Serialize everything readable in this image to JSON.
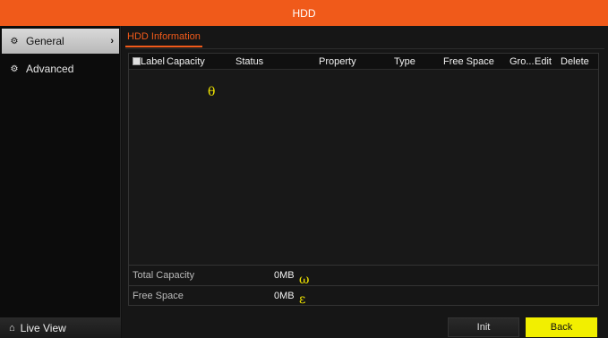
{
  "window": {
    "title": "HDD"
  },
  "sidebar": {
    "items": [
      {
        "label": "General",
        "icon": "gear-icon",
        "active": true
      },
      {
        "label": "Advanced",
        "icon": "settings-icon",
        "active": false
      }
    ],
    "live_view": {
      "label": "Live View",
      "icon": "home-icon"
    }
  },
  "main": {
    "tabs": [
      {
        "label": "HDD Information"
      }
    ],
    "table": {
      "columns": [
        "Label",
        "Capacity",
        "Status",
        "Property",
        "Type",
        "Free Space",
        "Gro...",
        "Edit",
        "Delete"
      ],
      "rows": []
    },
    "summary": {
      "total_capacity": {
        "label": "Total Capacity",
        "value": "0MB"
      },
      "free_space": {
        "label": "Free Space",
        "value": "0MB"
      }
    },
    "markers": {
      "theta": "θ",
      "omega": "ω",
      "epsilon": "ε"
    },
    "buttons": {
      "init": "Init",
      "back": "Back"
    }
  },
  "colors": {
    "accent": "#f05a1a",
    "back_button": "#f2ef00",
    "marker": "#f2e600"
  }
}
